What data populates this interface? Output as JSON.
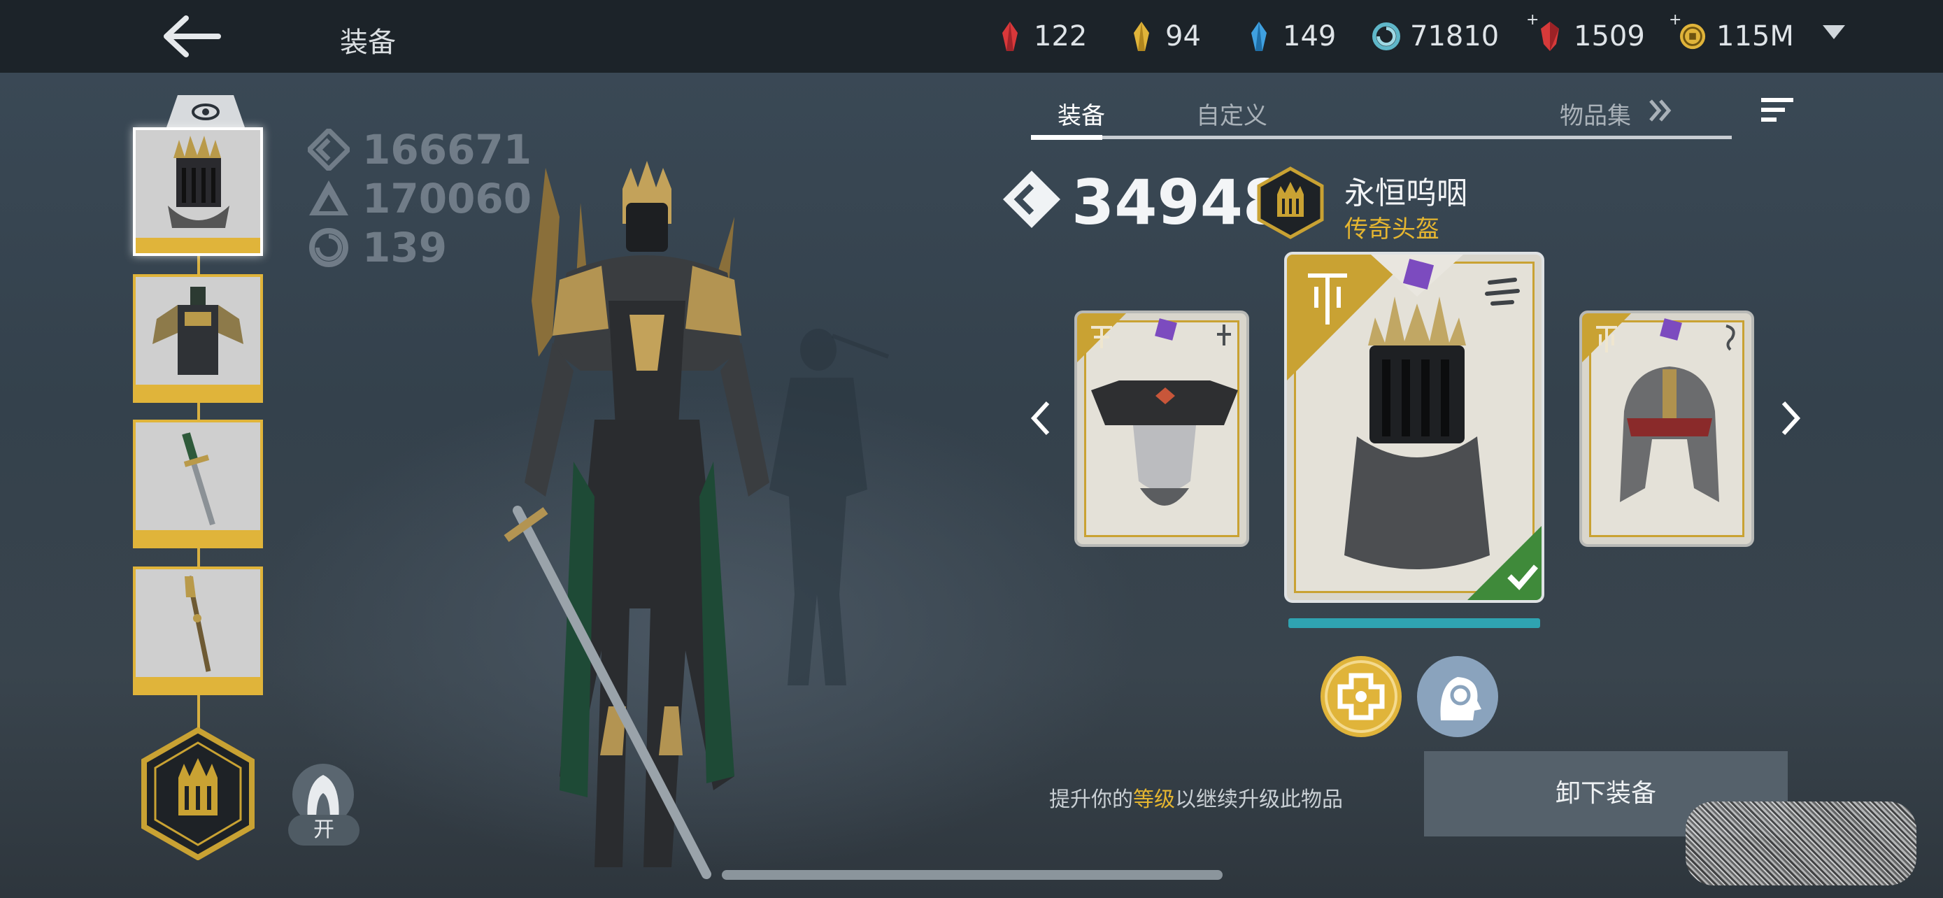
{
  "header": {
    "title": "装备",
    "currencies": [
      {
        "icon": "red-crystal-icon",
        "value": "122",
        "color": "#d9383a"
      },
      {
        "icon": "gold-crystal-icon",
        "value": "94",
        "color": "#e0b43a"
      },
      {
        "icon": "blue-crystal-icon",
        "value": "149",
        "color": "#3fa0e0"
      },
      {
        "icon": "swirl-icon",
        "value": "71810",
        "color": "#5fb7c9"
      },
      {
        "icon": "ruby-icon",
        "value": "1509",
        "color": "#d63a3a",
        "plus": "+"
      },
      {
        "icon": "coin-icon",
        "value": "115M",
        "color": "#e0b43a",
        "plus": "+"
      }
    ]
  },
  "stats": [
    {
      "icon": "power-icon",
      "value": "166671"
    },
    {
      "icon": "triangle-stat-icon",
      "value": "170060"
    },
    {
      "icon": "swirl-stat-icon",
      "value": "139"
    }
  ],
  "hood_toggle": {
    "label": "开"
  },
  "tabs": [
    {
      "label": "装备",
      "active": true
    },
    {
      "label": "自定义",
      "active": false
    },
    {
      "label": "物品集",
      "active": false
    }
  ],
  "item": {
    "power": "34948",
    "name": "永恒呜咽",
    "rarity": "传奇头盔"
  },
  "upgrade_hint": {
    "prefix": "提升你的",
    "highlight": "等级",
    "suffix": "以继续升级此物品"
  },
  "unequip_label": "卸下装备",
  "colors": {
    "accent": "#e0b43a",
    "equipped": "#3f8a3a",
    "cyan": "#2fa3b1"
  }
}
